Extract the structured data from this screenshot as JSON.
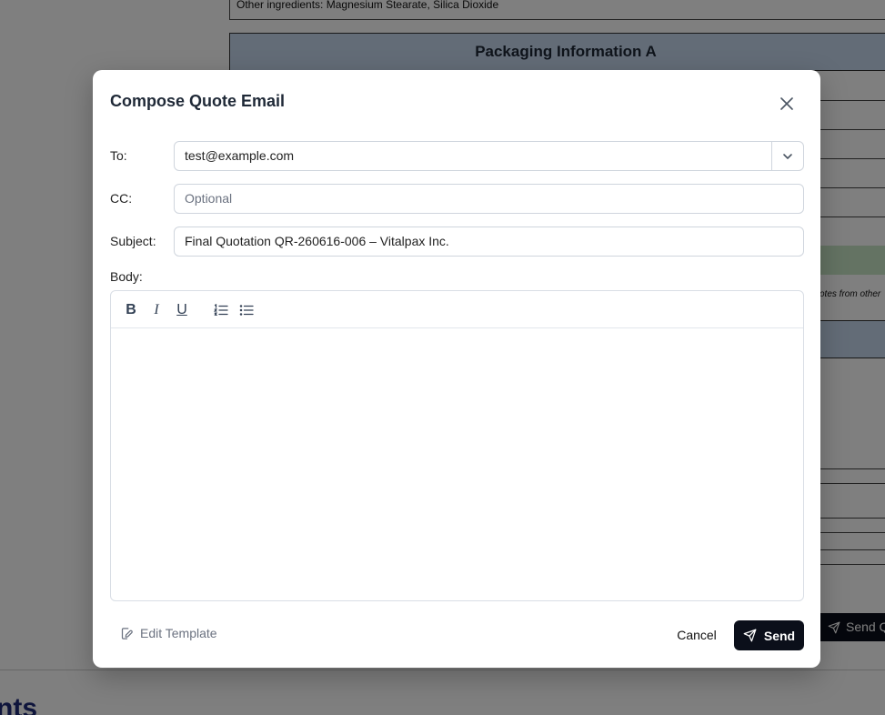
{
  "background": {
    "ingredients_text": "Other ingredients: Magnesium Stearate, Silica Dioxide",
    "packaging_header": "Packaging Information A",
    "note_fragment": "otes from other",
    "send_button_fragment": "Send Q",
    "heading_fragment": "nts"
  },
  "modal": {
    "title": "Compose Quote Email",
    "to": {
      "label": "To:",
      "value": "test@example.com"
    },
    "cc": {
      "label": "CC:",
      "placeholder": "Optional",
      "value": ""
    },
    "subject": {
      "label": "Subject:",
      "value": "Final Quotation QR-260616-006 – Vitalpax Inc."
    },
    "body": {
      "label": "Body:",
      "value": ""
    },
    "toolbar": {
      "bold": "B",
      "italic": "I",
      "underline": "U"
    },
    "footer": {
      "edit_template_label": "Edit Template",
      "cancel_label": "Cancel",
      "send_label": "Send"
    }
  },
  "colors": {
    "primary_button": "#0b0f1a",
    "overlay": "rgba(0,0,0,0.5)",
    "header_blue": "#c6d8ef",
    "header_green": "#c9e7c6"
  }
}
